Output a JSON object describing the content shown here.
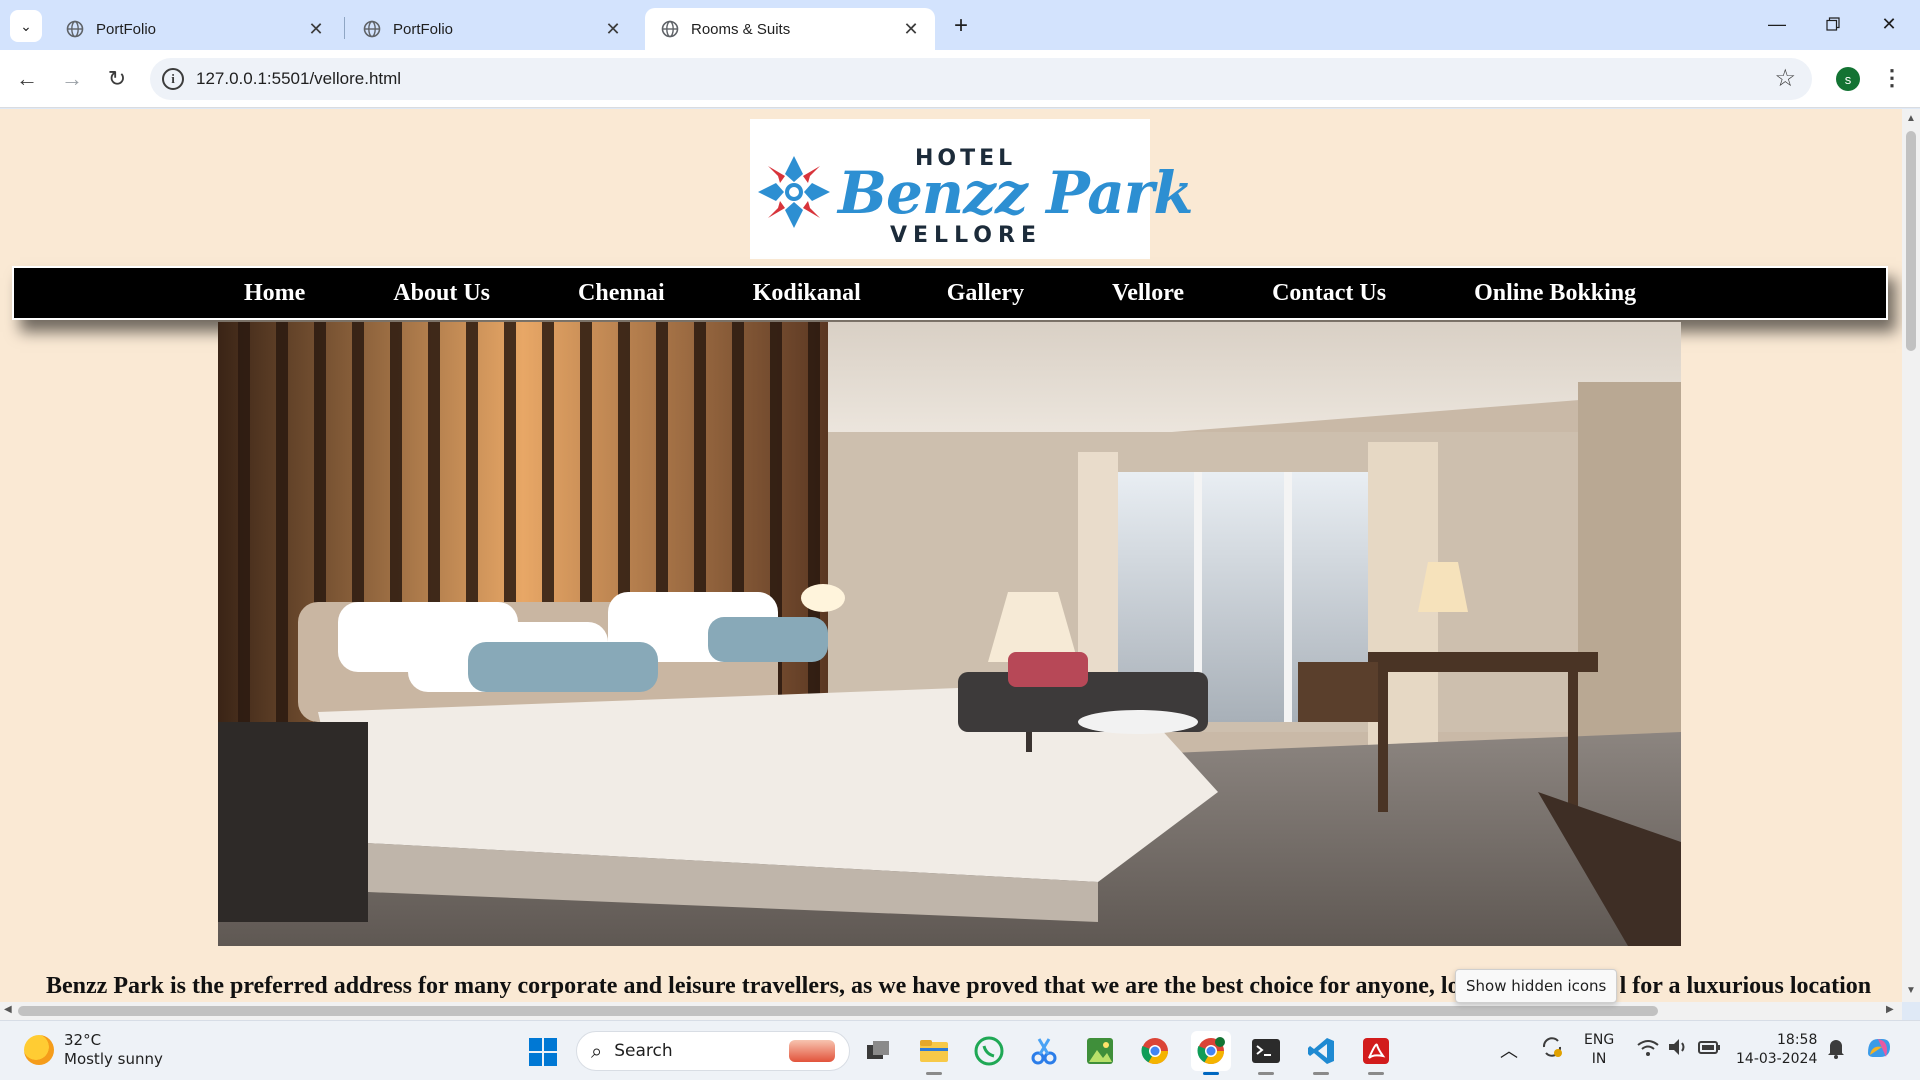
{
  "browser": {
    "tabs": [
      {
        "label": "PortFolio",
        "active": false
      },
      {
        "label": "PortFolio",
        "active": false
      },
      {
        "label": "Rooms & Suits",
        "active": true
      }
    ],
    "url": "127.0.0.1:5501/vellore.html",
    "profile_initial": "s"
  },
  "page": {
    "logo": {
      "hotel": "HOTEL",
      "brand": "Benzz Park",
      "city": "VELLORE"
    },
    "nav": [
      "Home",
      "About Us",
      "Chennai",
      "Kodikanal",
      "Gallery",
      "Vellore",
      "Contact Us",
      "Online Bokking"
    ],
    "intro_text": "Benzz Park is the preferred address for many corporate and leisure travellers, as we have proved that we are the best choice for anyone, lo",
    "intro_text_tail": "l for a luxurious location",
    "colors": {
      "page_bg": "#fae9d4",
      "nav_bg": "#000000",
      "brand_blue": "#2d8fd2"
    }
  },
  "tooltip": "Show hidden icons",
  "taskbar": {
    "weather_temp": "32°C",
    "weather_desc": "Mostly sunny",
    "search_placeholder": "Search",
    "apps": [
      "windows-start-icon",
      "task-view-icon",
      "file-explorer-icon",
      "whatsapp-icon",
      "snipping-tool-icon",
      "photos-icon",
      "chrome-icon",
      "chrome-profile-icon",
      "terminal-icon",
      "vscode-icon",
      "acrobat-icon"
    ],
    "lang_top": "ENG",
    "lang_bottom": "IN",
    "time": "18:58",
    "date": "14-03-2024"
  }
}
